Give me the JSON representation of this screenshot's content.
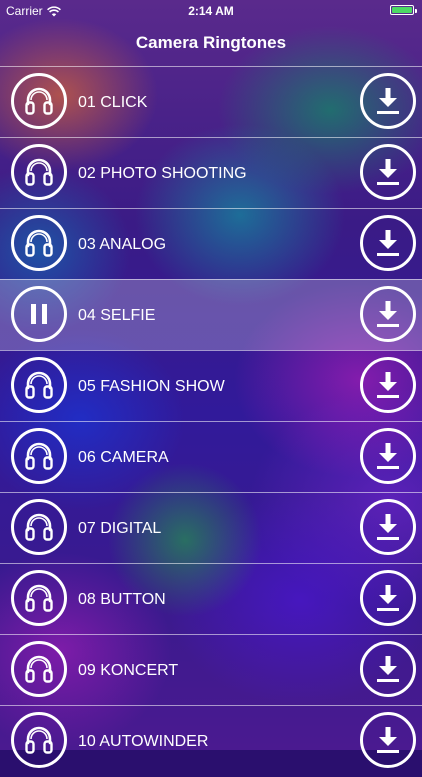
{
  "status_bar": {
    "carrier": "Carrier",
    "time": "2:14 AM",
    "wifi_icon": "wifi-icon",
    "battery_icon": "battery-icon",
    "battery_color": "#4cd964"
  },
  "nav": {
    "title": "Camera Ringtones"
  },
  "ringtones": [
    {
      "title": "01 CLICK",
      "state": "idle",
      "left_icon": "headphones-icon",
      "right_icon": "download-icon"
    },
    {
      "title": "02 PHOTO SHOOTING",
      "state": "idle",
      "left_icon": "headphones-icon",
      "right_icon": "download-icon"
    },
    {
      "title": "03 ANALOG",
      "state": "idle",
      "left_icon": "headphones-icon",
      "right_icon": "download-icon"
    },
    {
      "title": "04 SELFIE",
      "state": "playing",
      "left_icon": "pause-icon",
      "right_icon": "download-icon"
    },
    {
      "title": "05 FASHION SHOW",
      "state": "idle",
      "left_icon": "headphones-icon",
      "right_icon": "download-icon"
    },
    {
      "title": "06 CAMERA",
      "state": "idle",
      "left_icon": "headphones-icon",
      "right_icon": "download-icon"
    },
    {
      "title": "07 DIGITAL",
      "state": "idle",
      "left_icon": "headphones-icon",
      "right_icon": "download-icon"
    },
    {
      "title": "08 BUTTON",
      "state": "idle",
      "left_icon": "headphones-icon",
      "right_icon": "download-icon"
    },
    {
      "title": "09 KONCERT",
      "state": "idle",
      "left_icon": "headphones-icon",
      "right_icon": "download-icon"
    },
    {
      "title": "10 AUTOWINDER",
      "state": "idle",
      "left_icon": "headphones-icon",
      "right_icon": "download-icon"
    }
  ]
}
